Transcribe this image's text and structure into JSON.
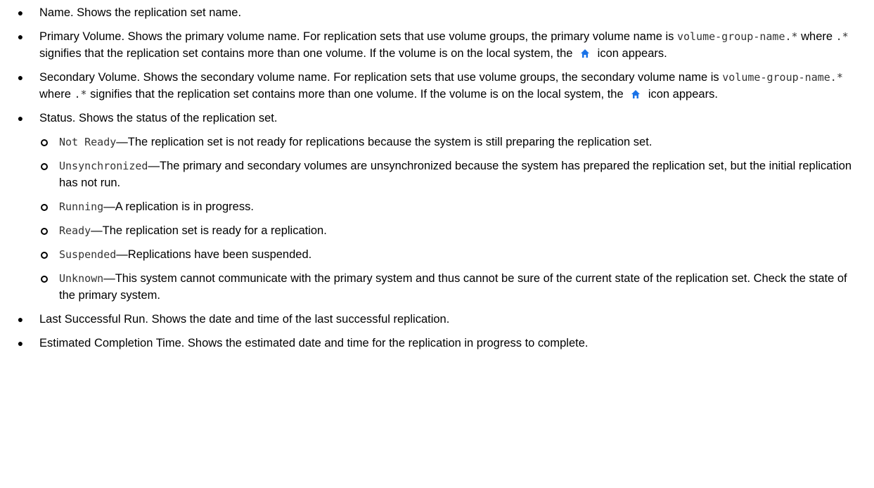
{
  "colors": {
    "text": "#000000",
    "code": "#333333",
    "home_icon": "#1a73e8"
  },
  "icons": {
    "home": "home-icon"
  },
  "items": {
    "name": {
      "text": "Name. Shows the replication set name."
    },
    "primary": {
      "t1": "Primary Volume. Shows the primary volume name. For replication sets that use volume groups, the primary volume name is ",
      "code1": "volume-group-name.*",
      "t2": " where ",
      "code2": ".*",
      "t3": " signifies that the replication set contains more than one volume. If the volume is on the local system, the ",
      "t4": " icon appears."
    },
    "secondary": {
      "t1": "Secondary Volume. Shows the secondary volume name. For replication sets that use volume groups, the secondary volume name is ",
      "code1": "volume-group-name.*",
      "t2": " where ",
      "code2": ".*",
      "t3": " signifies that the replication set contains more than one volume. If the volume is on the local system, the ",
      "t4": " icon appears."
    },
    "status": {
      "text": "Status. Shows the status of the replication set.",
      "states": [
        {
          "code": "Not Ready",
          "desc": "—The replication set is not ready for replications because the system is still preparing the replication set."
        },
        {
          "code": "Unsynchronized",
          "desc": "—The primary and secondary volumes are unsynchronized because the system has prepared the replication set, but the initial replication has not run."
        },
        {
          "code": "Running",
          "desc": "—A replication is in progress."
        },
        {
          "code": "Ready",
          "desc": "—The replication set is ready for a replication."
        },
        {
          "code": "Suspended",
          "desc": "—Replications have been suspended."
        },
        {
          "code": "Unknown",
          "desc": "—This system cannot communicate with the primary system and thus cannot be sure of the current state of the replication set. Check the state of the primary system."
        }
      ]
    },
    "last_run": {
      "text": "Last Successful Run. Shows the date and time of the last successful replication."
    },
    "estimated": {
      "text": "Estimated Completion Time. Shows the estimated date and time for the replication in progress to complete."
    }
  }
}
